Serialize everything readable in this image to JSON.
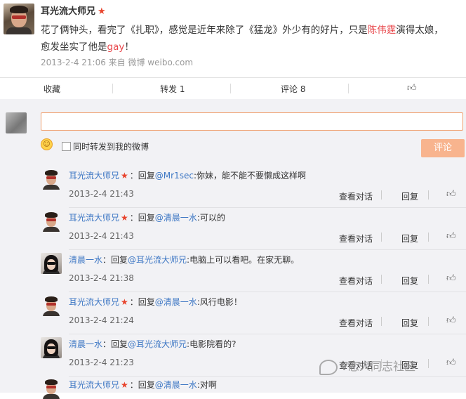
{
  "post": {
    "author": "耳光流大师兄",
    "text_1": "花了俩钟头，看完了《扎职》，感觉是近年来除了《猛龙》外少有的好片，只是",
    "text_name": "陈伟霆",
    "text_2": "演得太娘，",
    "text_3": "愈发坐实了他是",
    "text_gay": "gay",
    "text_4": "！",
    "meta": "2013-2-4 21:06 来自 微博 weibo.com"
  },
  "actions": {
    "collect": "收藏",
    "repost": "转发 1",
    "comment": "评论 8"
  },
  "compose": {
    "checkbox_label": "同时转发到我的微博",
    "submit_label": "评论"
  },
  "comment_labels": {
    "view_dialog": "查看对话",
    "reply": "回复"
  },
  "comments": [
    {
      "author": "耳光流大师兄",
      "prefix": "：回复",
      "mention": "@Mr1sec",
      "text": ":你妹，能不能不要懒成这样啊",
      "time": "2013-2-4 21:43"
    },
    {
      "author": "耳光流大师兄",
      "prefix": "：回复",
      "mention": "@清晨一水",
      "text": ":可以的",
      "time": "2013-2-4 21:43"
    },
    {
      "author": "清晨一水",
      "prefix": "：回复",
      "mention": "@耳光流大师兄",
      "text": ":电脑上可以看吧。在家无聊。",
      "time": "2013-2-4 21:38"
    },
    {
      "author": "耳光流大师兄",
      "prefix": "：回复",
      "mention": "@清晨一水",
      "text": ":风行电影！",
      "time": "2013-2-4 21:24"
    },
    {
      "author": "清晨一水",
      "prefix": "：回复",
      "mention": "@耳光流大师兄",
      "text": ":电影院看的?",
      "time": "2013-2-4 21:23"
    },
    {
      "author": "耳光流大师兄",
      "prefix": "：回复",
      "mention": "@清晨一水",
      "text": ":对啊"
    }
  ],
  "watermark": "V恋人同志社区",
  "icons": {
    "vip": "star-icon",
    "like": "thumbs-up-icon",
    "emoji": "smile-icon"
  }
}
